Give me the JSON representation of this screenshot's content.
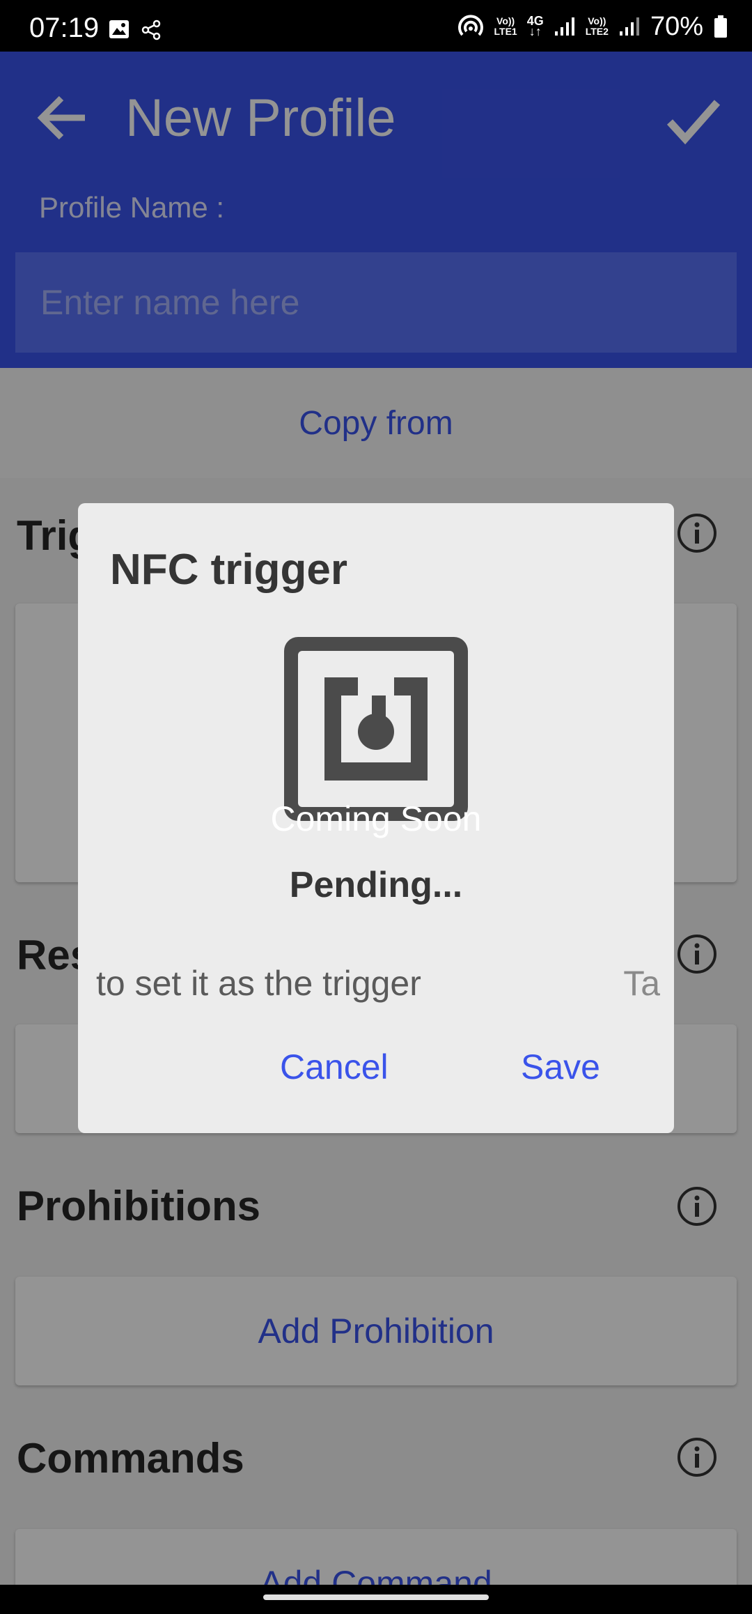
{
  "status_bar": {
    "time": "07:19",
    "net1_top": "Vo))",
    "net1_bottom": "LTE1",
    "net_mid_top": "4G",
    "net_mid_bottom": "↓↑",
    "net2_top": "Vo))",
    "net2_bottom": "LTE2",
    "battery": "70%"
  },
  "app_bar": {
    "title": "New Profile",
    "profile_name_label": "Profile Name :",
    "name_placeholder": "Enter name here"
  },
  "main": {
    "copy_from": "Copy from",
    "sections": {
      "triggers_partial": "Trig",
      "restrictions_partial": "Res",
      "prohibitions": "Prohibitions",
      "commands": "Commands"
    },
    "add_prohibition": "Add Prohibition",
    "add_command": "Add Command"
  },
  "dialog": {
    "title": "NFC trigger",
    "coming_soon": "Coming Soon",
    "pending": "Pending...",
    "instruction_partial": "to set it as the trigger",
    "instruction_right_partial": "Ta",
    "cancel": "Cancel",
    "save": "Save"
  },
  "colors": {
    "accent": "#3a53ea",
    "scrim": "rgba(0,0,0,0.42)"
  }
}
